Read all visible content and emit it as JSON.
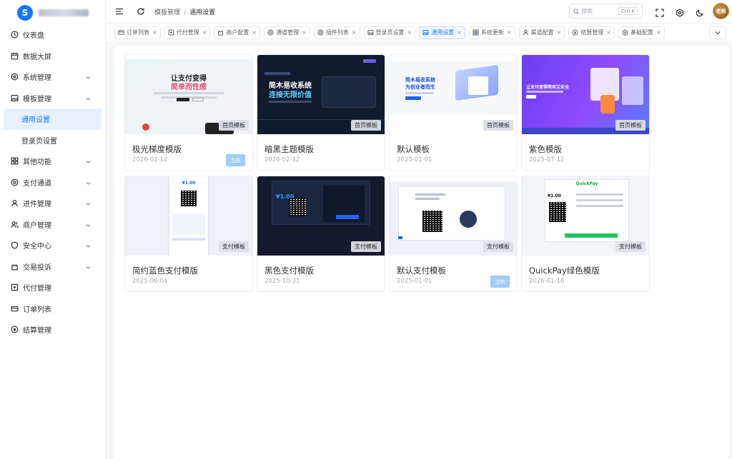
{
  "app": {
    "logo_glyph": "S"
  },
  "sidebar": {
    "items": [
      {
        "label": "仪表盘",
        "icon": "clock-icon",
        "expandable": false
      },
      {
        "label": "数据大屏",
        "icon": "calendar-icon",
        "expandable": false
      },
      {
        "label": "系统管理",
        "icon": "gear-icon",
        "expandable": true
      },
      {
        "label": "模板管理",
        "icon": "image-icon",
        "expandable": true,
        "expanded": true
      },
      {
        "label": "通用设置",
        "sub": true,
        "active": true
      },
      {
        "label": "登录页设置",
        "sub": true
      },
      {
        "label": "其他功能",
        "icon": "grid-icon",
        "expandable": true
      },
      {
        "label": "支付通道",
        "icon": "target-icon",
        "expandable": true
      },
      {
        "label": "进件管理",
        "icon": "user-icon",
        "expandable": true
      },
      {
        "label": "商户管理",
        "icon": "users-icon",
        "expandable": true
      },
      {
        "label": "安全中心",
        "icon": "shield-icon",
        "expandable": true
      },
      {
        "label": "交易投诉",
        "icon": "complaint-icon",
        "expandable": true
      },
      {
        "label": "代付管理",
        "icon": "transfer-icon",
        "expandable": false
      },
      {
        "label": "订单列表",
        "icon": "card-icon",
        "expandable": false
      },
      {
        "label": "结算管理",
        "icon": "settle-icon",
        "expandable": false
      }
    ]
  },
  "header": {
    "breadcrumb": [
      "模板管理",
      "通用设置"
    ],
    "search_placeholder": "搜索",
    "search_shortcut": "Ctrl K",
    "avatar_text": "老师"
  },
  "tabs": [
    {
      "label": "订单列表",
      "icon": "card-icon"
    },
    {
      "label": "代付管理",
      "icon": "transfer-icon"
    },
    {
      "label": "商户配置",
      "icon": "complaint-icon"
    },
    {
      "label": "通道管理",
      "icon": "target-icon"
    },
    {
      "label": "插件列表",
      "icon": "target-icon"
    },
    {
      "label": "登录页设置",
      "icon": "image-icon"
    },
    {
      "label": "通用设置",
      "icon": "image-icon",
      "active": true
    },
    {
      "label": "系统更新",
      "icon": "grid-icon"
    },
    {
      "label": "渠道配置",
      "icon": "user-icon"
    },
    {
      "label": "结算管理",
      "icon": "settle-icon"
    },
    {
      "label": "基础配置",
      "icon": "gear-icon"
    }
  ],
  "templates": [
    {
      "name": "极光梯度模版",
      "date": "2026-02-12",
      "tag": "首页模板",
      "current": true,
      "current_label": "当前",
      "thumb_text": [
        "让支付变得",
        "简单而性感"
      ]
    },
    {
      "name": "暗黑主题模版",
      "date": "2026-02-12",
      "tag": "首页模板",
      "current": false,
      "thumb_text": [
        "简木易收系统",
        "连接无限价值"
      ]
    },
    {
      "name": "默认模板",
      "date": "2025-01-01",
      "tag": "首页模板",
      "current": false,
      "thumb_text": [
        "简木易收系统",
        "为创业者而生"
      ]
    },
    {
      "name": "紫色模版",
      "date": "2025-07-12",
      "tag": "首页模板",
      "current": false,
      "thumb_text": [
        "让支付变得简单又安全"
      ]
    },
    {
      "name": "简约蓝色支付模版",
      "date": "2025-06-04",
      "tag": "支付模板",
      "current": false,
      "thumb_text": [
        "¥1.00"
      ]
    },
    {
      "name": "黑色支付模版",
      "date": "2025-10-31",
      "tag": "支付模板",
      "current": false,
      "thumb_text": [
        "¥1.00"
      ]
    },
    {
      "name": "默认支付模板",
      "date": "2025-01-01",
      "tag": "支付模板",
      "current": true,
      "current_label": "当前",
      "thumb_text": []
    },
    {
      "name": "QuickPay绿色模版",
      "date": "2026-01-16",
      "tag": "支付模板",
      "current": false,
      "thumb_text": [
        "QuickPay",
        "¥1.00"
      ]
    }
  ]
}
